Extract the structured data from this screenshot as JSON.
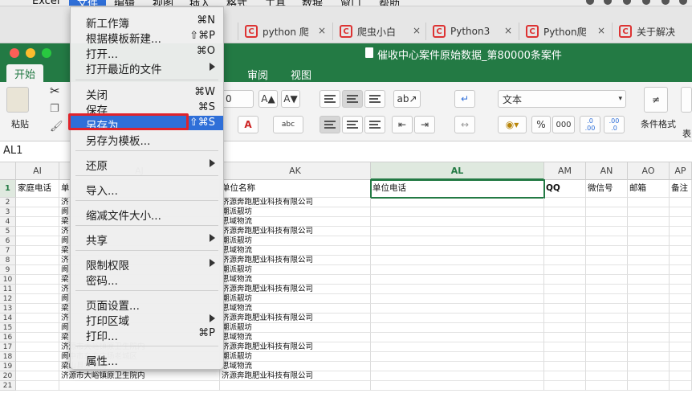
{
  "menubar": {
    "items": [
      "Excel",
      "文件",
      "编辑",
      "视图",
      "插入",
      "格式",
      "工具",
      "数据",
      "窗口",
      "帮助"
    ],
    "active_index": 1
  },
  "browser_tabs": [
    {
      "label": "python 爬",
      "icon": "C"
    },
    {
      "label": "爬虫小白",
      "icon": "C"
    },
    {
      "label": "Python3",
      "icon": "C"
    },
    {
      "label": "Python爬",
      "icon": "C"
    },
    {
      "label": "关于解决",
      "icon": "C"
    }
  ],
  "window": {
    "title": "催收中心案件原始数据_第80000条案件",
    "accent": "#237a44"
  },
  "ribbon": {
    "tabs": [
      "开始",
      "审阅",
      "视图"
    ],
    "active_tab": "开始",
    "paste_label": "粘贴",
    "font_size": "0",
    "number_format": "文本",
    "percent_symbol": "%",
    "thousands_label": "000",
    "decimal_increase_label": ".0\n.00",
    "decimal_decrease_label": ".00\n.0",
    "conditional_format_label": "条件格式",
    "table_label": "表"
  },
  "formula_bar": {
    "name_box": "AL1"
  },
  "grid": {
    "columns": [
      {
        "id": "AI"
      },
      {
        "id": "AJ"
      },
      {
        "id": "AK"
      },
      {
        "id": "AL"
      },
      {
        "id": "AM"
      },
      {
        "id": "AN"
      },
      {
        "id": "AO"
      },
      {
        "id": "AP"
      }
    ],
    "selected_column": "AL",
    "selected_row": "1",
    "header_row": [
      "家庭电话",
      "单",
      "单位名称",
      "单位电话",
      "QQ",
      "微信号",
      "邮箱",
      "备注"
    ],
    "rows": [
      {
        "n": "2",
        "aj": "济",
        "ak": "济源奔跑肥业科技有限公司"
      },
      {
        "n": "3",
        "aj": "阆",
        "ak": "潮派靓坊"
      },
      {
        "n": "4",
        "aj": "梁",
        "ak": "思域物流"
      },
      {
        "n": "5",
        "aj": "济",
        "ak": "济源奔跑肥业科技有限公司"
      },
      {
        "n": "6",
        "aj": "阆",
        "ak": "潮派靓坊"
      },
      {
        "n": "7",
        "aj": "梁",
        "ak": "思域物流"
      },
      {
        "n": "8",
        "aj": "济",
        "ak": "济源奔跑肥业科技有限公司"
      },
      {
        "n": "9",
        "aj": "阆",
        "ak": "潮派靓坊"
      },
      {
        "n": "10",
        "aj": "梁",
        "ak": "思域物流"
      },
      {
        "n": "11",
        "aj": "济",
        "ak": "济源奔跑肥业科技有限公司"
      },
      {
        "n": "12",
        "aj": "阆",
        "ak": "潮派靓坊"
      },
      {
        "n": "13",
        "aj": "梁",
        "ak": "思域物流"
      },
      {
        "n": "14",
        "aj": "济",
        "ak": "济源奔跑肥业科技有限公司"
      },
      {
        "n": "15",
        "aj": "阆",
        "ak": "潮派靓坊"
      },
      {
        "n": "16",
        "aj": "梁",
        "ak": "思域物流"
      },
      {
        "n": "17",
        "aj": "济源市大峪镇原卫生院内",
        "ak": "济源奔跑肥业科技有限公司"
      },
      {
        "n": "18",
        "aj": "阆中市东方广场老城区",
        "ak": "潮派靓坊"
      },
      {
        "n": "19",
        "aj": "梁山县水浒街",
        "ak": "思域物流"
      },
      {
        "n": "20",
        "aj": "济源市大峪镇原卫生院内",
        "ak": "济源奔跑肥业科技有限公司"
      },
      {
        "n": "21",
        "aj": "",
        "ak": ""
      }
    ]
  },
  "file_menu": {
    "items": [
      {
        "label": "新工作簿",
        "shortcut": "⌘N",
        "submenu": false
      },
      {
        "label": "根据模板新建...",
        "shortcut": "⇧⌘P",
        "submenu": false
      },
      {
        "label": "打开...",
        "shortcut": "⌘O",
        "submenu": false
      },
      {
        "label": "打开最近的文件",
        "shortcut": "",
        "submenu": true
      },
      {
        "label": "关闭",
        "shortcut": "⌘W",
        "submenu": false
      },
      {
        "label": "保存",
        "shortcut": "⌘S",
        "submenu": false
      },
      {
        "label": "另存为...",
        "shortcut": "⇧⌘S",
        "submenu": false
      },
      {
        "label": "另存为模板...",
        "shortcut": "",
        "submenu": false
      },
      {
        "label": "还原",
        "shortcut": "",
        "submenu": true
      },
      {
        "label": "导入...",
        "shortcut": "",
        "submenu": false
      },
      {
        "label": "缩减文件大小...",
        "shortcut": "",
        "submenu": false
      },
      {
        "label": "共享",
        "shortcut": "",
        "submenu": true
      },
      {
        "label": "限制权限",
        "shortcut": "",
        "submenu": true
      },
      {
        "label": "密码...",
        "shortcut": "",
        "submenu": false
      },
      {
        "label": "页面设置...",
        "shortcut": "",
        "submenu": false
      },
      {
        "label": "打印区域",
        "shortcut": "",
        "submenu": true
      },
      {
        "label": "打印...",
        "shortcut": "⌘P",
        "submenu": false
      },
      {
        "label": "属性...",
        "shortcut": "",
        "submenu": false
      }
    ],
    "highlighted_index": 6,
    "highlight_color": "#2f6fd8",
    "annotation_color": "#e0232b"
  }
}
